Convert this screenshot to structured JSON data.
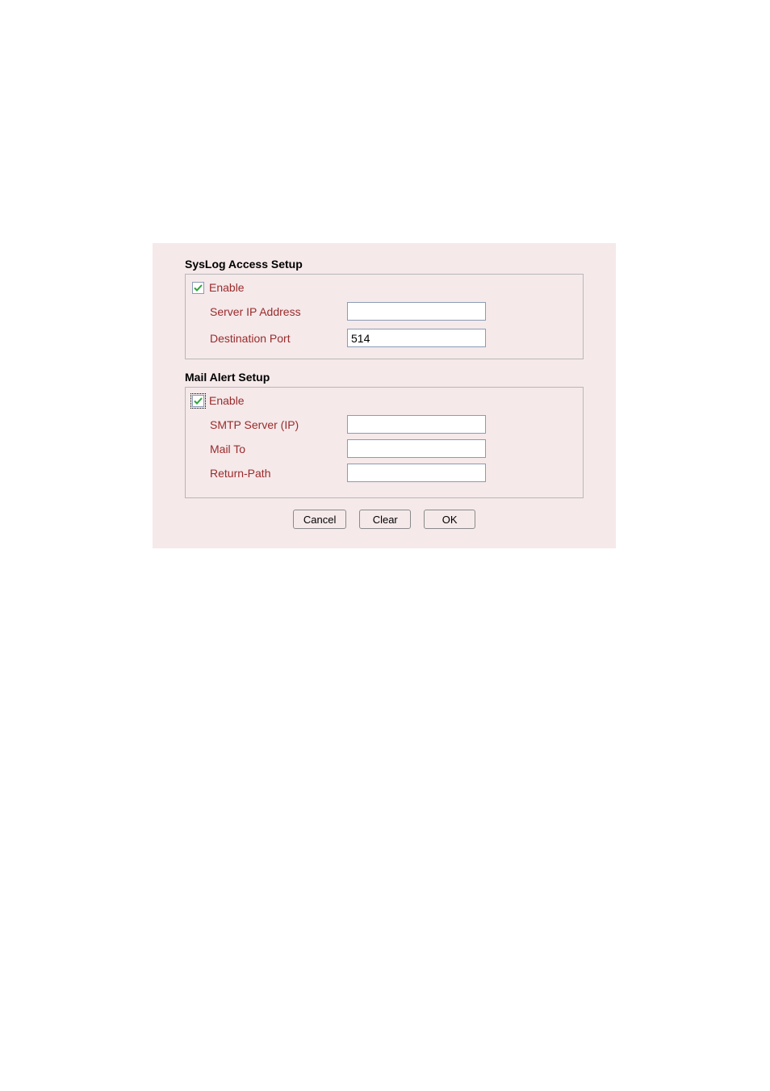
{
  "syslog": {
    "title": "SysLog Access Setup",
    "enable_label": "Enable",
    "enable_checked": true,
    "server_ip_label": "Server IP Address",
    "server_ip_value": "",
    "dest_port_label": "Destination Port",
    "dest_port_value": "514"
  },
  "mail": {
    "title": "Mail Alert Setup",
    "enable_label": "Enable",
    "enable_checked": true,
    "smtp_label": "SMTP Server (IP)",
    "smtp_value": "",
    "mailto_label": "Mail To",
    "mailto_value": "",
    "return_label": "Return-Path",
    "return_value": ""
  },
  "buttons": {
    "cancel": "Cancel",
    "clear": "Clear",
    "ok": "OK"
  },
  "colors": {
    "panel_bg": "#f5e9ea",
    "label_text": "#9a2b2b",
    "check_green": "#2fa43a"
  }
}
